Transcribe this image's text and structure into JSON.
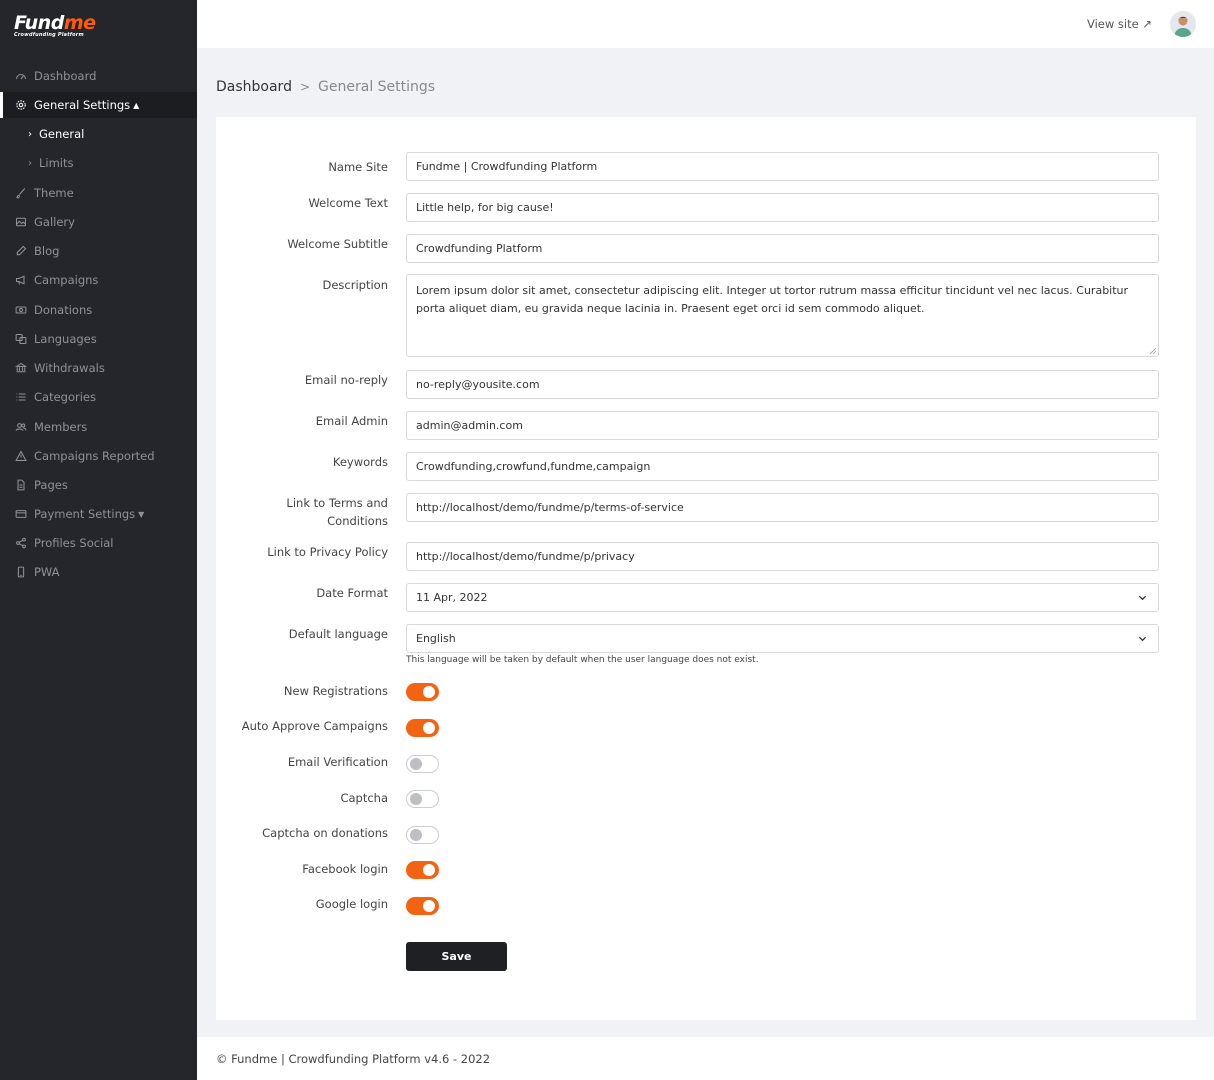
{
  "app": {
    "logo_main": "Fund",
    "logo_accent": "me",
    "logo_tagline": "Crowdfunding Platform"
  },
  "sidebar": {
    "items": [
      {
        "label": "Dashboard",
        "icon": "speedometer-icon"
      },
      {
        "label": "General Settings",
        "icon": "gear-icon",
        "caret": "▲"
      },
      {
        "label": "General",
        "icon": "chevron-right-icon"
      },
      {
        "label": "Limits",
        "icon": "chevron-right-icon"
      },
      {
        "label": "Theme",
        "icon": "brush-icon"
      },
      {
        "label": "Gallery",
        "icon": "image-icon"
      },
      {
        "label": "Blog",
        "icon": "pencil-icon"
      },
      {
        "label": "Campaigns",
        "icon": "megaphone-icon"
      },
      {
        "label": "Donations",
        "icon": "cash-icon"
      },
      {
        "label": "Languages",
        "icon": "translate-icon"
      },
      {
        "label": "Withdrawals",
        "icon": "bank-icon"
      },
      {
        "label": "Categories",
        "icon": "list-icon"
      },
      {
        "label": "Members",
        "icon": "people-icon"
      },
      {
        "label": "Campaigns Reported",
        "icon": "warning-icon"
      },
      {
        "label": "Pages",
        "icon": "file-icon"
      },
      {
        "label": "Payment Settings",
        "icon": "credit-card-icon",
        "caret": "▼"
      },
      {
        "label": "Profiles Social",
        "icon": "share-icon"
      },
      {
        "label": "PWA",
        "icon": "phone-icon"
      }
    ]
  },
  "topbar": {
    "view_site": "View site ↗"
  },
  "breadcrumb": {
    "home": "Dashboard",
    "current": "General Settings"
  },
  "form": {
    "name_site": {
      "label": "Name Site",
      "value": "Fundme | Crowdfunding Platform"
    },
    "welcome_text": {
      "label": "Welcome Text",
      "value": "Little help, for big cause!"
    },
    "welcome_subtitle": {
      "label": "Welcome Subtitle",
      "value": "Crowdfunding Platform"
    },
    "description": {
      "label": "Description",
      "value": "Lorem ipsum dolor sit amet, consectetur adipiscing elit. Integer ut tortor rutrum massa efficitur tincidunt vel nec lacus. Curabitur porta aliquet diam, eu gravida neque lacinia in. Praesent eget orci id sem commodo aliquet."
    },
    "email_noreply": {
      "label": "Email no-reply",
      "value": "no-reply@yousite.com"
    },
    "email_admin": {
      "label": "Email Admin",
      "value": "admin@admin.com"
    },
    "keywords": {
      "label": "Keywords",
      "value": "Crowdfunding,crowfund,fundme,campaign"
    },
    "terms_link": {
      "label_line1": "Link to Terms and",
      "label_line2": "Conditions",
      "value": "http://localhost/demo/fundme/p/terms-of-service"
    },
    "privacy_link": {
      "label": "Link to Privacy Policy",
      "value": "http://localhost/demo/fundme/p/privacy"
    },
    "date_format": {
      "label": "Date Format",
      "value": "11 Apr, 2022"
    },
    "default_language": {
      "label": "Default language",
      "value": "English",
      "help": "This language will be taken by default when the user language does not exist."
    },
    "toggles": [
      {
        "label": "New Registrations",
        "on": true
      },
      {
        "label": "Auto Approve Campaigns",
        "on": true
      },
      {
        "label": "Email Verification",
        "on": false
      },
      {
        "label": "Captcha",
        "on": false
      },
      {
        "label": "Captcha on donations",
        "on": false
      },
      {
        "label": "Facebook login",
        "on": true
      },
      {
        "label": "Google login",
        "on": true
      }
    ],
    "save_label": "Save"
  },
  "colors": {
    "accent": "#f36412",
    "sidebar": "#24262b",
    "button": "#1e2024"
  },
  "footer": {
    "text": "© Fundme | Crowdfunding Platform v4.6 - 2022"
  }
}
